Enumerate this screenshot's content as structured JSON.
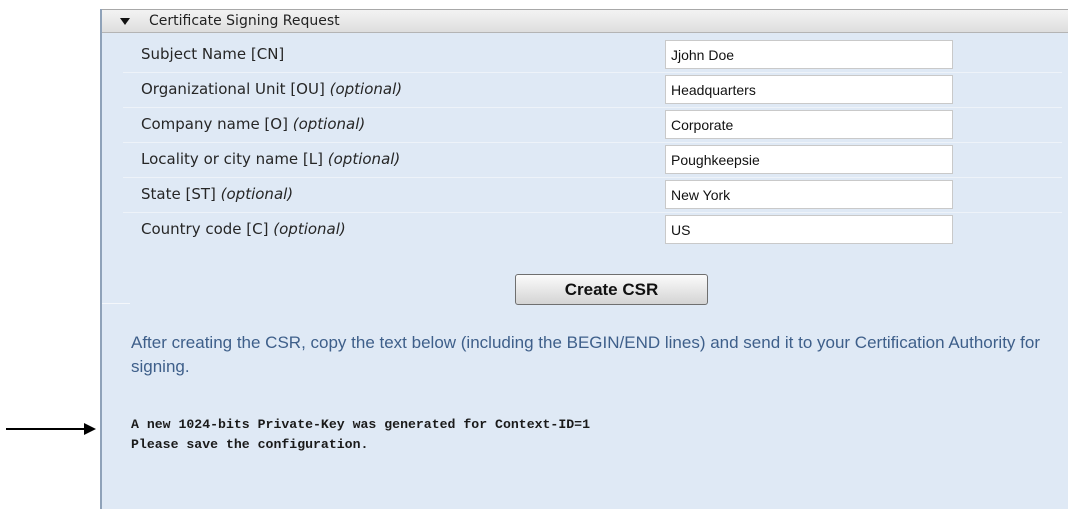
{
  "panel": {
    "title": "Certificate Signing Request"
  },
  "form": {
    "rows": [
      {
        "label": "Subject Name [CN]",
        "optional": "",
        "value": "Jjohn Doe"
      },
      {
        "label": "Organizational Unit [OU]",
        "optional": "(optional)",
        "value": "Headquarters"
      },
      {
        "label": "Company name [O]",
        "optional": "(optional)",
        "value": "Corporate"
      },
      {
        "label": "Locality or city name [L]",
        "optional": "(optional)",
        "value": "Poughkeepsie"
      },
      {
        "label": "State [ST]",
        "optional": "(optional)",
        "value": "New York"
      },
      {
        "label": "Country code [C]",
        "optional": "(optional)",
        "value": "US"
      }
    ]
  },
  "create_button_label": "Create CSR",
  "instructions": "After creating the CSR, copy the text below (including the BEGIN/END lines) and send it to your Certification Authority for signing.",
  "output": {
    "line1": "A new 1024-bits Private-Key was generated for Context-ID=1",
    "line2": "Please save the configuration."
  },
  "colors": {
    "panel_background": "#dfe9f5",
    "instruction_text": "#3e5f8a"
  },
  "icons": {
    "collapse": "triangle-down",
    "annotation": "arrow-right"
  }
}
